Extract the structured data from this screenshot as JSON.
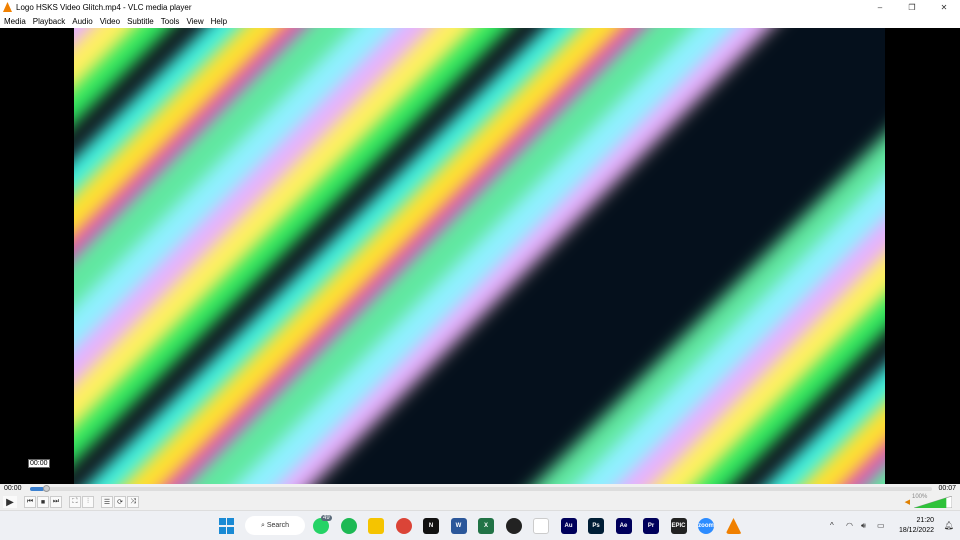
{
  "window": {
    "title": "Logo HSKS Video Glitch.mp4 - VLC media player",
    "minimize": "–",
    "restore": "❐",
    "close": "✕"
  },
  "menu": [
    "Media",
    "Playback",
    "Audio",
    "Video",
    "Subtitle",
    "Tools",
    "View",
    "Help"
  ],
  "player": {
    "tooltip": "00:00",
    "elapsed": "00:00",
    "duration": "00:07",
    "progress": 0.01,
    "volume_label": "100%",
    "volume": 1.0
  },
  "taskbar": {
    "search": "Search",
    "whatsapp_badge": "49",
    "time": "21:20",
    "date": "18/12/2022",
    "apps": [
      {
        "name": "whatsapp",
        "color": "#25d366",
        "label": ""
      },
      {
        "name": "spotify",
        "color": "#1db954",
        "label": ""
      },
      {
        "name": "file-explorer",
        "color": "#f5c400",
        "label": ""
      },
      {
        "name": "chrome",
        "color": "#db4437",
        "label": ""
      },
      {
        "name": "netflix",
        "color": "#111",
        "label": "N"
      },
      {
        "name": "word",
        "color": "#2b579a",
        "label": "W"
      },
      {
        "name": "excel",
        "color": "#217346",
        "label": "X"
      },
      {
        "name": "obs",
        "color": "#222",
        "label": ""
      },
      {
        "name": "capcut",
        "color": "#fff",
        "label": ""
      },
      {
        "name": "audition",
        "color": "#00005b",
        "label": "Au"
      },
      {
        "name": "photoshop",
        "color": "#001e36",
        "label": "Ps"
      },
      {
        "name": "after-effects",
        "color": "#00005b",
        "label": "Ae"
      },
      {
        "name": "premiere",
        "color": "#00005b",
        "label": "Pr"
      },
      {
        "name": "epic-games",
        "color": "#222",
        "label": "EPIC"
      },
      {
        "name": "zoom",
        "color": "#2d8cff",
        "label": "zoom"
      },
      {
        "name": "vlc",
        "color": "#f08000",
        "label": ""
      }
    ]
  }
}
